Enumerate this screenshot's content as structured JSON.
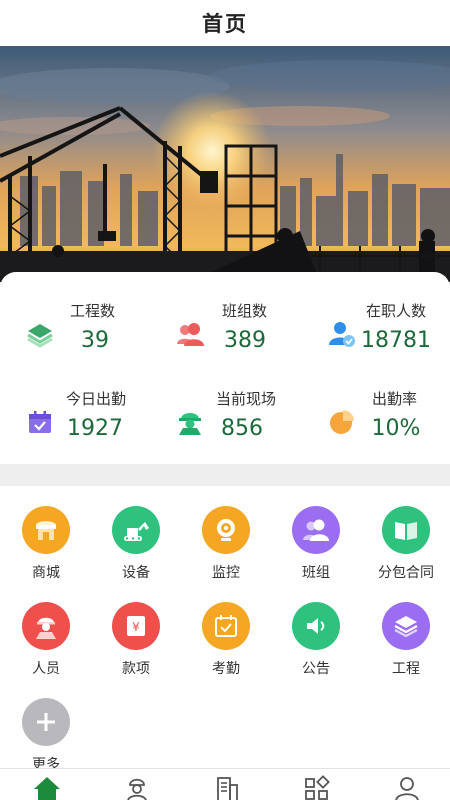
{
  "header": {
    "title": "首页"
  },
  "stats": [
    {
      "label": "工程数",
      "value": "39",
      "icon": "layers-icon"
    },
    {
      "label": "班组数",
      "value": "389",
      "icon": "team-icon"
    },
    {
      "label": "在职人数",
      "value": "18781",
      "icon": "verified-user-icon"
    },
    {
      "label": "今日出勤",
      "value": "1927",
      "icon": "calendar-check-icon"
    },
    {
      "label": "当前现场",
      "value": "856",
      "icon": "hardhat-worker-icon"
    },
    {
      "label": "出勤率",
      "value": "10%",
      "icon": "pie-chart-icon"
    }
  ],
  "grid": [
    {
      "label": "商城",
      "icon": "shop-icon",
      "color": "#f5a623"
    },
    {
      "label": "设备",
      "icon": "excavator-icon",
      "color": "#2ec27e"
    },
    {
      "label": "监控",
      "icon": "camera-icon",
      "color": "#f5a623"
    },
    {
      "label": "班组",
      "icon": "team-icon",
      "color": "#9b6df2"
    },
    {
      "label": "分包合同",
      "icon": "book-icon",
      "color": "#2ec27e"
    },
    {
      "label": "人员",
      "icon": "worker-icon",
      "color": "#f0504c"
    },
    {
      "label": "款项",
      "icon": "money-icon",
      "color": "#f0504c"
    },
    {
      "label": "考勤",
      "icon": "attendance-icon",
      "color": "#f5a623"
    },
    {
      "label": "公告",
      "icon": "speaker-icon",
      "color": "#2ec27e"
    },
    {
      "label": "工程",
      "icon": "layers-icon",
      "color": "#9b6df2"
    },
    {
      "label": "更多",
      "icon": "plus-icon",
      "color": "#b8b8bd"
    }
  ],
  "tabbar": [
    {
      "icon": "home-icon",
      "color": "#1c8c3c"
    },
    {
      "icon": "worker-icon",
      "color": "#555555"
    },
    {
      "icon": "building-icon",
      "color": "#555555"
    },
    {
      "icon": "apps-icon",
      "color": "#555555"
    },
    {
      "icon": "user-icon",
      "color": "#555555"
    }
  ]
}
